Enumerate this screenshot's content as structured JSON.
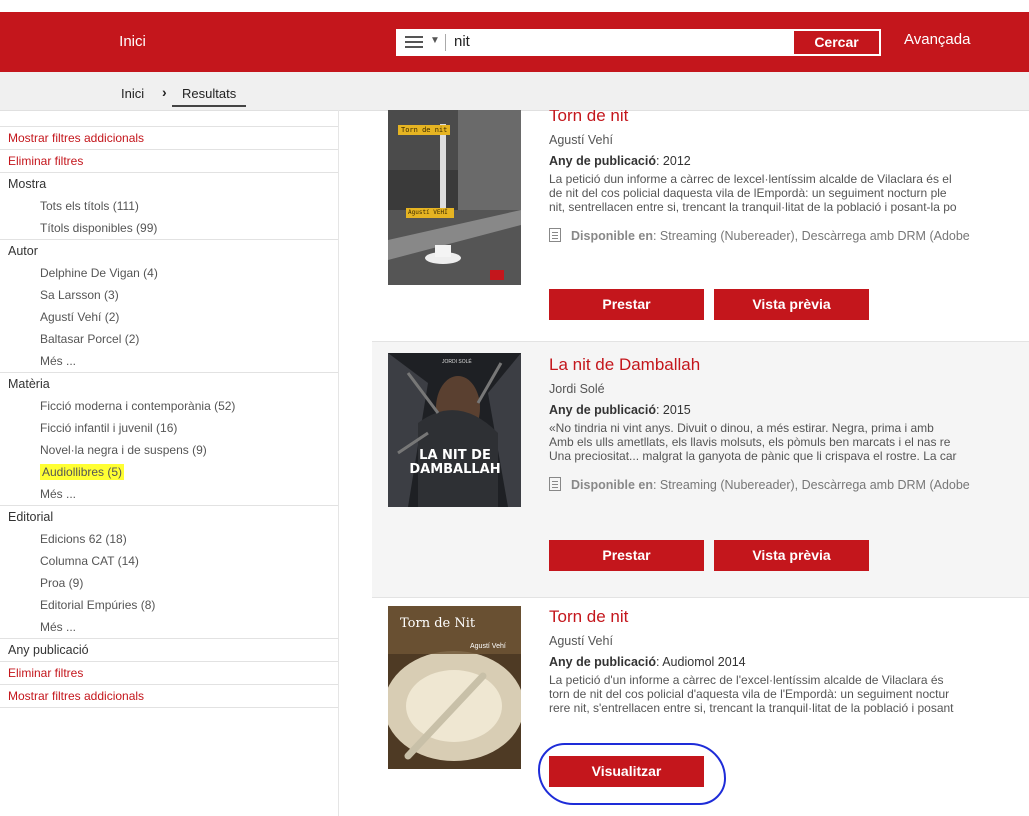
{
  "header": {
    "home": "Inici",
    "search_value": "nit",
    "search_button": "Cercar",
    "advanced": "Avançada"
  },
  "breadcrumb": {
    "home": "Inici",
    "separator": "›",
    "current": "Resultats"
  },
  "sidebar": {
    "show_filters_top": "Mostrar filtres addicionals",
    "clear_filters_top": "Eliminar filtres",
    "show_label": "Mostra",
    "show_items": [
      "Tots els títols (111)",
      "Títols disponibles (99)"
    ],
    "author_label": "Autor",
    "author_items": [
      "Delphine De Vigan (4)",
      "Sa Larsson (3)",
      "Agustí Vehí (2)",
      "Baltasar Porcel (2)",
      "Més ..."
    ],
    "subject_label": "Matèria",
    "subject_items": [
      "Ficció moderna i contemporània (52)",
      "Ficció infantil i juvenil (16)",
      "Novel·la negra i de suspens (9)",
      "Audiollibres (5)",
      "Més ..."
    ],
    "publisher_label": "Editorial",
    "publisher_items": [
      "Edicions 62 (18)",
      "Columna CAT (14)",
      "Proa (9)",
      "Editorial Empúries (8)",
      "Més ..."
    ],
    "year_label": "Any publicació",
    "clear_filters_bottom": "Eliminar filtres",
    "show_filters_bottom": "Mostrar filtres addicionals"
  },
  "results": [
    {
      "title": "Torn de nit",
      "author": "Agustí Vehí",
      "year_label": "Any de publicació",
      "year": ": 2012",
      "desc": [
        "La petició dun informe a càrrec de lexcel·lentíssim alcalde de Vilaclara és el",
        "de nit del cos policial daquesta vila de lEmpordà: un seguiment nocturn ple",
        "nit, sentrellacen entre si, trencant la tranquil·litat de la població i posant-la po"
      ],
      "avail_label": "Disponible en",
      "avail": ": Streaming (Nubereader), Descàrrega amb DRM (Adobe",
      "btn_borrow": "Prestar",
      "btn_preview": "Vista prèvia",
      "cover_title": "Torn de nit",
      "cover_author": "Agustí VEHÍ"
    },
    {
      "title": "La nit de Damballah",
      "author": "Jordi Solé",
      "year_label": "Any de publicació",
      "year": ": 2015",
      "desc": [
        "«No tindria ni vint anys. Divuit o dinou, a més estirar. Negra, prima i amb",
        "Amb els ulls ametllats, els llavis molsuts, els pòmuls ben marcats i el nas re",
        "Una preciositat... malgrat la ganyota de pànic que li crispava el rostre. La car"
      ],
      "avail_label": "Disponible en",
      "avail": ": Streaming (Nubereader), Descàrrega amb DRM (Adobe",
      "btn_borrow": "Prestar",
      "btn_preview": "Vista prèvia",
      "cover_title": "LA NIT DE DAMBALLAH",
      "cover_author": "JORDI SOLÉ"
    },
    {
      "title": "Torn de nit",
      "author": "Agustí Vehí",
      "year_label": "Any de publicació",
      "year": ": Audiomol 2014",
      "desc": [
        "La petició d'un informe a càrrec de l'excel·lentíssim alcalde de Vilaclara és",
        "torn de nit del cos policial d'aquesta vila de l'Empordà: un seguiment noctur",
        "rere nit, s'entrellacen entre si, trencant la tranquil·litat de la població i posant"
      ],
      "btn_view": "Visualitzar",
      "cover_title": "Torn de Nit",
      "cover_author": "Agustí Vehí"
    }
  ],
  "colors": {
    "brand": "#c4161c",
    "highlight": "#ffff33",
    "annotation": "#1e2cd8"
  }
}
